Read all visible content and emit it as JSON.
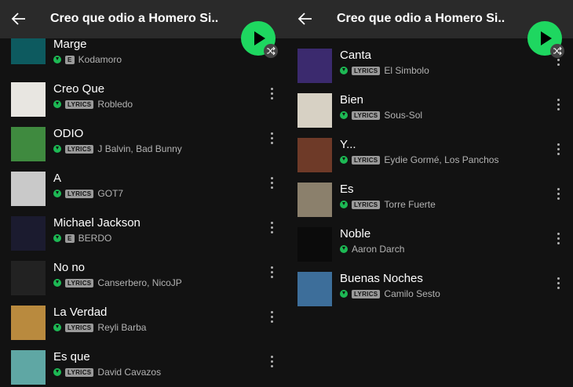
{
  "left": {
    "title": "Creo que odio a Homero Si...",
    "tracks": [
      {
        "title": "Marge",
        "badge": "E",
        "artist": "Kodamoro",
        "art_color": "#0d5a5f"
      },
      {
        "title": "Creo Que",
        "badge": "LYRICS",
        "artist": "Robledo",
        "art_color": "#e8e6e1"
      },
      {
        "title": "ODIO",
        "badge": "LYRICS",
        "artist": "J Balvin, Bad Bunny",
        "art_color": "#3f8a3f"
      },
      {
        "title": "A",
        "badge": "LYRICS",
        "artist": "GOT7",
        "art_color": "#c9c9c9"
      },
      {
        "title": "Michael Jackson",
        "badge": "E",
        "artist": "BERDO",
        "art_color": "#1b1b2f"
      },
      {
        "title": "No no",
        "badge": "LYRICS",
        "artist": "Canserbero, NicoJP",
        "art_color": "#222222"
      },
      {
        "title": "La Verdad",
        "badge": "LYRICS",
        "artist": "Reyli Barba",
        "art_color": "#b98a3e"
      },
      {
        "title": "Es que",
        "badge": "LYRICS",
        "artist": "David Cavazos",
        "art_color": "#5fa7a4"
      }
    ]
  },
  "right": {
    "title": "Creo que odio a Homero Si...",
    "tracks": [
      {
        "title": "Canta",
        "badge": "LYRICS",
        "artist": "El Simbolo",
        "art_color": "#3b2a6e"
      },
      {
        "title": "Bien",
        "badge": "LYRICS",
        "artist": "Sous-Sol",
        "art_color": "#d7d1c4"
      },
      {
        "title": "Y...",
        "badge": "LYRICS",
        "artist": "Eydie Gormé, Los Panchos",
        "art_color": "#6e3a28"
      },
      {
        "title": "Es",
        "badge": "LYRICS",
        "artist": "Torre Fuerte",
        "art_color": "#8b806c"
      },
      {
        "title": "Noble",
        "badge": "",
        "artist": "Aaron Darch",
        "art_color": "#0b0b0b"
      },
      {
        "title": "Buenas Noches",
        "badge": "LYRICS",
        "artist": "Camilo Sesto",
        "art_color": "#3d6e9a"
      }
    ]
  },
  "colors": {
    "accent": "#1ed760",
    "background": "#121212",
    "header": "#2a2a2a",
    "subtext": "#b3b3b3"
  },
  "icons": {
    "back": "arrow-left-icon",
    "play": "play-icon",
    "shuffle": "shuffle-icon",
    "more": "more-vertical-icon",
    "download": "downloaded-icon"
  }
}
